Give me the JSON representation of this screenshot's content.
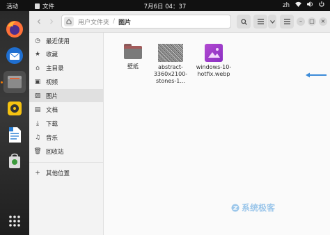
{
  "topbar": {
    "activities": "活动",
    "app_name": "文件",
    "clock": "7月6日  04：37",
    "input_method": "zh"
  },
  "header": {
    "path_parent": "用户文件夹",
    "path_current": "图片"
  },
  "sidebar": {
    "items": [
      {
        "icon": "clock-icon",
        "label": "最近使用"
      },
      {
        "icon": "star-icon",
        "label": "收藏"
      },
      {
        "icon": "home-icon",
        "label": "主目录"
      },
      {
        "icon": "video-icon",
        "label": "视频"
      },
      {
        "icon": "image-icon",
        "label": "图片"
      },
      {
        "icon": "document-icon",
        "label": "文档"
      },
      {
        "icon": "download-icon",
        "label": "下载"
      },
      {
        "icon": "music-icon",
        "label": "音乐"
      },
      {
        "icon": "trash-icon",
        "label": "回收站"
      }
    ],
    "other_locations": "其他位置"
  },
  "files": [
    {
      "name": "壁纸",
      "type": "folder"
    },
    {
      "name": "abstract-3360x2100-stones-1...",
      "type": "image"
    },
    {
      "name": "windows-10-hotfix.webp",
      "type": "image"
    }
  ],
  "watermark": "系统极客"
}
